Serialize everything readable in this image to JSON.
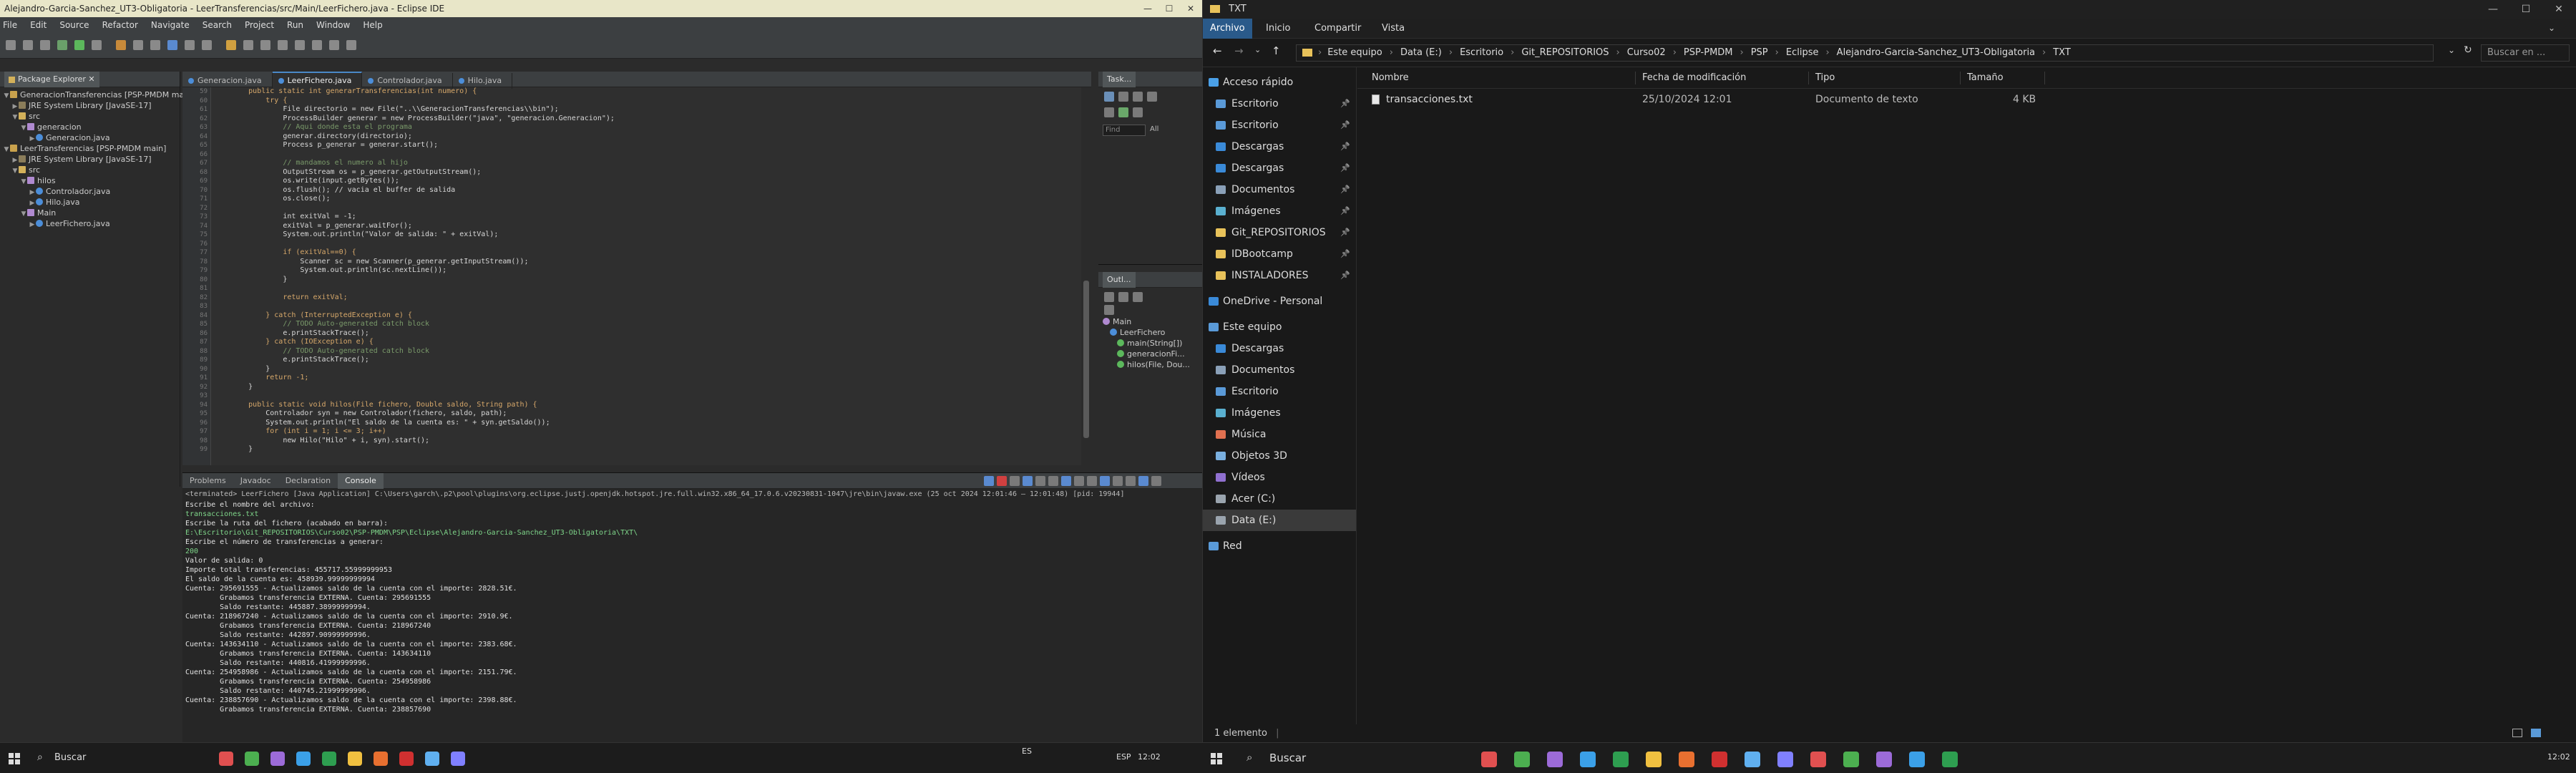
{
  "eclipse": {
    "title": "Alejandro-Garcia-Sanchez_UT3-Obligatoria - LeerTransferencias/src/Main/LeerFichero.java - Eclipse IDE",
    "menu": [
      "File",
      "Edit",
      "Source",
      "Refactor",
      "Navigate",
      "Search",
      "Project",
      "Run",
      "Window",
      "Help"
    ],
    "package_explorer": {
      "title": "Package Explorer",
      "tree": [
        {
          "label": "GeneracionTransferencias [PSP-PMDM main]",
          "indent": 0,
          "icon": "proj",
          "tw": "▼"
        },
        {
          "label": "JRE System Library [JavaSE-17]",
          "indent": 1,
          "icon": "lib",
          "tw": "▶"
        },
        {
          "label": "src",
          "indent": 1,
          "icon": "src",
          "tw": "▼"
        },
        {
          "label": "generacion",
          "indent": 2,
          "icon": "pack",
          "tw": "▼"
        },
        {
          "label": "Generacion.java",
          "indent": 3,
          "icon": "java",
          "tw": "▶"
        },
        {
          "label": "LeerTransferencias [PSP-PMDM main]",
          "indent": 0,
          "icon": "proj",
          "tw": "▼"
        },
        {
          "label": "JRE System Library [JavaSE-17]",
          "indent": 1,
          "icon": "lib",
          "tw": "▶"
        },
        {
          "label": "src",
          "indent": 1,
          "icon": "src",
          "tw": "▼"
        },
        {
          "label": "hilos",
          "indent": 2,
          "icon": "pack",
          "tw": "▼"
        },
        {
          "label": "Controlador.java",
          "indent": 3,
          "icon": "java",
          "tw": "▶"
        },
        {
          "label": "Hilo.java",
          "indent": 3,
          "icon": "java",
          "tw": "▶"
        },
        {
          "label": "Main",
          "indent": 2,
          "icon": "pack",
          "tw": "▼"
        },
        {
          "label": "LeerFichero.java",
          "indent": 3,
          "icon": "java",
          "tw": "▶"
        }
      ]
    },
    "editor_tabs": [
      {
        "label": "Generacion.java",
        "active": false
      },
      {
        "label": "LeerFichero.java",
        "active": true
      },
      {
        "label": "Controlador.java",
        "active": false
      },
      {
        "label": "Hilo.java",
        "active": false
      }
    ],
    "code_start_line": 59,
    "code": [
      "        public static int generarTransferencias(int numero) {",
      "            try {",
      "                File directorio = new File(\"..\\\\GeneracionTransferencias\\\\bin\");",
      "                ProcessBuilder generar = new ProcessBuilder(\"java\", \"generacion.Generacion\");",
      "                // Aqui donde esta el programa",
      "                generar.directory(directorio);",
      "                Process p_generar = generar.start();",
      "",
      "                // mandamos el numero al hijo",
      "                OutputStream os = p_generar.getOutputStream();",
      "                os.write(input.getBytes());",
      "                os.flush(); // vacia el buffer de salida",
      "                os.close();",
      "",
      "                int exitVal = -1;",
      "                exitVal = p_generar.waitFor();",
      "                System.out.println(\"Valor de salida: \" + exitVal);",
      "",
      "                if (exitVal==0) {",
      "                    Scanner sc = new Scanner(p_generar.getInputStream());",
      "                    System.out.println(sc.nextLine());",
      "                }",
      "",
      "                return exitVal;",
      "",
      "            } catch (InterruptedException e) {",
      "                // TODO Auto-generated catch block",
      "                e.printStackTrace();",
      "            } catch (IOException e) {",
      "                // TODO Auto-generated catch block",
      "                e.printStackTrace();",
      "            }",
      "            return -1;",
      "        }",
      "",
      "        public static void hilos(File fichero, Double saldo, String path) {",
      "            Controlador syn = new Controlador(fichero, saldo, path);",
      "            System.out.println(\"El saldo de la cuenta es: \" + syn.getSaldo());",
      "            for (int i = 1; i <= 3; i++)",
      "                new Hilo(\"Hilo\" + i, syn).start();",
      "        }"
    ],
    "task_title": "Task...",
    "task_filter": "Find",
    "task_all": "All",
    "outline_title": "Outl...",
    "outline": [
      {
        "label": "Main",
        "indent": 0
      },
      {
        "label": "LeerFichero",
        "indent": 1
      },
      {
        "label": "main(String[])",
        "indent": 2
      },
      {
        "label": "generacionFi...",
        "indent": 2
      },
      {
        "label": "hilos(File, Dou...",
        "indent": 2
      }
    ],
    "console_tabs": [
      {
        "label": "Problems",
        "active": false
      },
      {
        "label": "Javadoc",
        "active": false
      },
      {
        "label": "Declaration",
        "active": false
      },
      {
        "label": "Console",
        "active": true
      }
    ],
    "console_path": "<terminated> LeerFichero [Java Application] C:\\Users\\garch\\.p2\\pool\\plugins\\org.eclipse.justj.openjdk.hotspot.jre.full.win32.x86_64_17.0.6.v20230831-1047\\jre\\bin\\javaw.exe  (25 oct 2024 12:01:46 – 12:01:48) [pid: 19944]",
    "console_lines": [
      {
        "text": "Escribe el nombre del archivo:",
        "input": false
      },
      {
        "text": "transacciones.txt",
        "input": true
      },
      {
        "text": "Escribe la ruta del fichero (acabado en barra):",
        "input": false
      },
      {
        "text": "E:\\Escritorio\\Git_REPOSITORIOS\\Curso02\\PSP-PMDM\\PSP\\Eclipse\\Alejandro-Garcia-Sanchez_UT3-Obligatoria\\TXT\\",
        "input": true
      },
      {
        "text": "Escribe el número de transferencias a generar:",
        "input": false
      },
      {
        "text": "200",
        "input": true
      },
      {
        "text": "Valor de salida: 0",
        "input": false
      },
      {
        "text": "Importe total transferencias: 455717.55999999953",
        "input": false
      },
      {
        "text": "El saldo de la cuenta es: 458939.99999999994",
        "input": false
      },
      {
        "text": "Cuenta: 295691555 - Actualizamos saldo de la cuenta con el importe: 2828.51€.",
        "input": false
      },
      {
        "text": "        Grabamos transferencia EXTERNA. Cuenta: 295691555",
        "input": false
      },
      {
        "text": "        Saldo restante: 445887.38999999994.",
        "input": false
      },
      {
        "text": "Cuenta: 218967240 - Actualizamos saldo de la cuenta con el importe: 2910.9€.",
        "input": false
      },
      {
        "text": "        Grabamos transferencia EXTERNA. Cuenta: 218967240",
        "input": false
      },
      {
        "text": "        Saldo restante: 442897.90999999996.",
        "input": false
      },
      {
        "text": "Cuenta: 143634110 - Actualizamos saldo de la cuenta con el importe: 2383.68€.",
        "input": false
      },
      {
        "text": "        Grabamos transferencia EXTERNA. Cuenta: 143634110",
        "input": false
      },
      {
        "text": "        Saldo restante: 440816.41999999996.",
        "input": false
      },
      {
        "text": "Cuenta: 254958986 - Actualizamos saldo de la cuenta con el importe: 2151.79€.",
        "input": false
      },
      {
        "text": "        Grabamos transferencia EXTERNA. Cuenta: 254958986",
        "input": false
      },
      {
        "text": "        Saldo restante: 440745.21999999996.",
        "input": false
      },
      {
        "text": "Cuenta: 238857690 - Actualizamos saldo de la cuenta con el importe: 2398.88€.",
        "input": false
      },
      {
        "text": "        Grabamos transferencia EXTERNA. Cuenta: 238857690",
        "input": false
      }
    ]
  },
  "explorer": {
    "title": "TXT",
    "ribbon": [
      "Archivo",
      "Inicio",
      "Compartir",
      "Vista"
    ],
    "breadcrumb": [
      "Este equipo",
      "Data (E:)",
      "Escritorio",
      "Git_REPOSITORIOS",
      "Curso02",
      "PSP-PMDM",
      "PSP",
      "Eclipse",
      "Alejandro-Garcia-Sanchez_UT3-Obligatoria",
      "TXT"
    ],
    "search_placeholder": "Buscar en ...",
    "nav": [
      {
        "label": "Acceso rápido",
        "type": "quick",
        "pin": false,
        "group": true
      },
      {
        "label": "Escritorio",
        "type": "desk",
        "pin": true
      },
      {
        "label": "Escritorio",
        "type": "desk",
        "pin": true
      },
      {
        "label": "Descargas",
        "type": "dl",
        "pin": true
      },
      {
        "label": "Descargas",
        "type": "dl",
        "pin": true
      },
      {
        "label": "Documentos",
        "type": "doc",
        "pin": true
      },
      {
        "label": "Imágenes",
        "type": "img",
        "pin": true
      },
      {
        "label": "Git_REPOSITORIOS",
        "type": "folder",
        "pin": true
      },
      {
        "label": "IDBootcamp",
        "type": "folder",
        "pin": true
      },
      {
        "label": "INSTALADORES",
        "type": "folder",
        "pin": true
      },
      {
        "label": "OneDrive - Personal",
        "type": "cloud",
        "pin": false,
        "group": true
      },
      {
        "label": "Este equipo",
        "type": "pc",
        "pin": false,
        "group": true
      },
      {
        "label": "Descargas",
        "type": "dl",
        "pin": false
      },
      {
        "label": "Documentos",
        "type": "doc",
        "pin": false
      },
      {
        "label": "Escritorio",
        "type": "desk",
        "pin": false
      },
      {
        "label": "Imágenes",
        "type": "img",
        "pin": false
      },
      {
        "label": "Música",
        "type": "music",
        "pin": false
      },
      {
        "label": "Objetos 3D",
        "type": "obj",
        "pin": false
      },
      {
        "label": "Vídeos",
        "type": "video",
        "pin": false
      },
      {
        "label": "Acer (C:)",
        "type": "drive",
        "pin": false
      },
      {
        "label": "Data (E:)",
        "type": "drive",
        "pin": false,
        "selected": true
      },
      {
        "label": "Red",
        "type": "net",
        "pin": false,
        "group": true
      }
    ],
    "columns": [
      "Nombre",
      "Fecha de modificación",
      "Tipo",
      "Tamaño"
    ],
    "files": [
      {
        "name": "transacciones.txt",
        "date": "25/10/2024 12:01",
        "type": "Documento de texto",
        "size": "4 KB"
      }
    ],
    "status": "1 elemento"
  },
  "taskbar": {
    "search_left": "Buscar",
    "search_right": "Buscar",
    "lang1": "ES",
    "lang2": "ESP",
    "time_left": "12:02",
    "time_right": "12:02",
    "colors": [
      "#e05050",
      "#4caf50",
      "#9c6bd8",
      "#3ba0e8",
      "#2e9e50",
      "#f0c040",
      "#e87030",
      "#d03030",
      "#60b0f0",
      "#8080ff"
    ]
  }
}
